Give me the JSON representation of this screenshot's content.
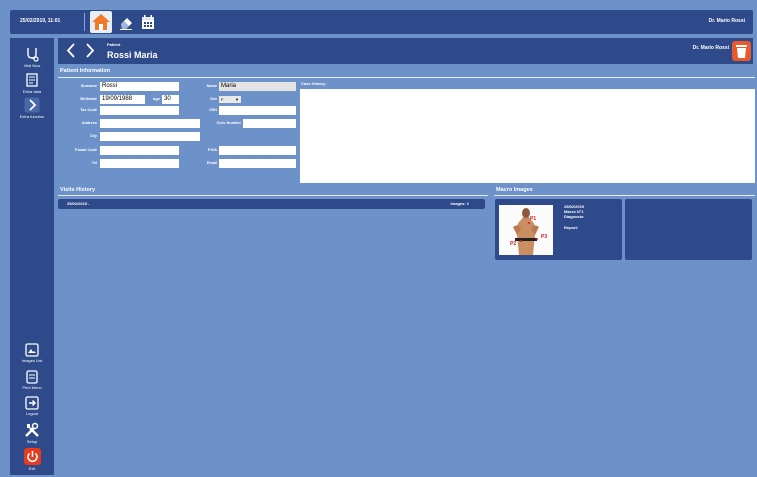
{
  "topbar": {
    "datetime": "25/02/2019, 11:01",
    "user": "Dr. Mario Rossi",
    "icons": [
      "home-icon",
      "eraser-icon",
      "calendar-icon"
    ]
  },
  "sidebar": {
    "items": [
      {
        "label": "Visit Now",
        "icon": "visit-now-icon"
      },
      {
        "label": "Extra data",
        "icon": "extra-data-icon"
      },
      {
        "label": "Extra function",
        "icon": "chevron-right-icon"
      },
      {
        "label": "Images List",
        "icon": "images-list-icon"
      },
      {
        "label": "Print Menu",
        "icon": "print-menu-icon"
      },
      {
        "label": "Logout",
        "icon": "logout-icon"
      },
      {
        "label": "Setup",
        "icon": "setup-icon"
      },
      {
        "label": "Exit",
        "icon": "power-icon"
      }
    ]
  },
  "header": {
    "small_label": "Patient",
    "patient_name": "Rossi Maria",
    "user": "Dr. Mario Rossi"
  },
  "patient_info": {
    "title": "Patient Information",
    "surname_label": "Surname",
    "surname": "Rossi",
    "name_label": "Name",
    "name": "Maria",
    "birthdate_label": "Birthdate",
    "birthdate": "19/09/1988",
    "age_label": "Age",
    "age": "30",
    "sex_label": "Sex",
    "sex": "F",
    "tax_code_label": "Tax Code",
    "tax_code": "",
    "ssn_label": "SSN",
    "ssn": "",
    "address_label": "Address",
    "address": "",
    "civic_label": "Civic Number",
    "civic": "",
    "city_label": "City",
    "city": "",
    "postal_label": "Postal Code",
    "postal": "",
    "piva_label": "P.IVA",
    "piva": "",
    "tel_label": "Tel",
    "tel": "",
    "email_label": "Email",
    "email": "",
    "case_history_label": "Case History"
  },
  "visits": {
    "title": "Visits History",
    "rows": [
      {
        "date": "25/02/2019 -",
        "images": "Images: 1"
      }
    ]
  },
  "macro": {
    "title": "Macro Images",
    "card": {
      "date": "25/02/2019",
      "macro_no": "Macro N°1",
      "diagnosis": "Diagnosis:",
      "report": "Report:",
      "markers": [
        "P1",
        "P2",
        "P3"
      ]
    }
  },
  "colors": {
    "background": "#6d91c9",
    "panel": "#2e4a8a",
    "accent_orange": "#f07a2a",
    "exit_red": "#e83a1e"
  }
}
